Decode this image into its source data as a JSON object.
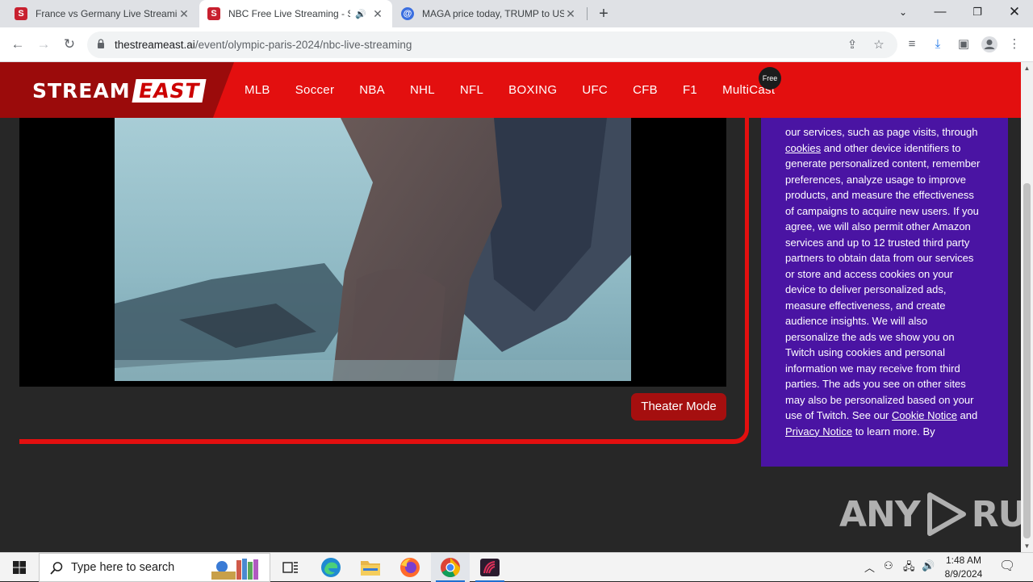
{
  "browser": {
    "tabs": [
      {
        "title": "France vs Germany Live Streamin",
        "favicon": "streameast-icon"
      },
      {
        "title": "NBC Free Live Streaming - S",
        "favicon": "streameast-icon",
        "active": true,
        "audio": true
      },
      {
        "title": "MAGA price today, TRUMP to US",
        "favicon": "coingecko-icon"
      }
    ],
    "url_host": "thestreameast.ai",
    "url_path": "/event/olympic-paris-2024/nbc-live-streaming"
  },
  "site": {
    "logo_left": "STREAM",
    "logo_right": "EAST",
    "nav": [
      "MLB",
      "Soccer",
      "NBA",
      "NHL",
      "NFL",
      "BOXING",
      "UFC",
      "CFB",
      "F1",
      "MultiCast"
    ],
    "free_badge": "Free",
    "theater_button": "Theater Mode",
    "colors": {
      "header": "#e30f0f",
      "logo_bg": "#9b0b0b",
      "consent_bg": "#4a14a3",
      "page_bg": "#272727"
    }
  },
  "consent": {
    "t1": "our services, such as page visits, through ",
    "l1": "cookies",
    "t2": " and other device identifiers to generate personalized content, remember preferences, analyze usage to improve products, and measure the effectiveness of campaigns to acquire new users. If you agree, we will also permit other Amazon services and up to 12 trusted third party partners to obtain data from our services or store and access cookies on your device to deliver personalized ads, measure effectiveness, and create audience insights. We will also personalize the ads we show you on Twitch using cookies and personal information we may receive from third parties. The ads you see on other sites may also be personalized based on your use of Twitch. See our ",
    "l2": "Cookie Notice",
    "t3": " and ",
    "l3": "Privacy Notice",
    "t4": " to learn more. By"
  },
  "watermark": {
    "left": "ANY",
    "right": "RUN"
  },
  "taskbar": {
    "search_placeholder": "Type here to search",
    "time": "1:48 AM",
    "date": "8/9/2024"
  }
}
